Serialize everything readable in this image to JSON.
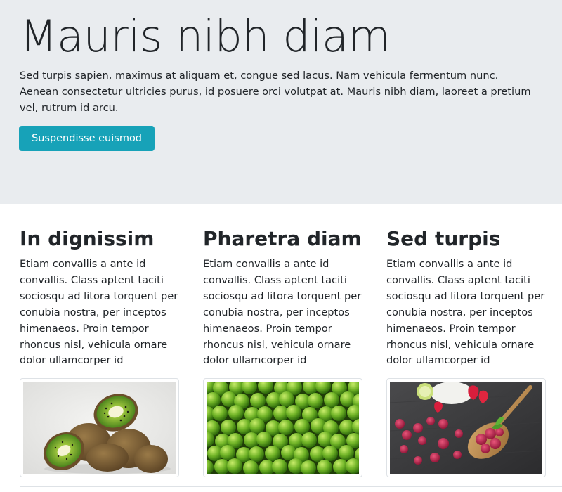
{
  "hero": {
    "title": "Mauris nibh diam",
    "lead": "Sed turpis sapien, maximus at aliquam et, congue sed lacus. Nam vehicula fermentum nunc. Aenean consectetur ultricies purus, id posuere orci volutpat at. Mauris nibh diam, laoreet a pretium vel, rutrum id arcu.",
    "button_label": "Suspendisse euismod",
    "button_color": "#17a2b8",
    "background": "#e9ecef"
  },
  "columns": [
    {
      "title": "In dignissim",
      "text": "Etiam convallis a ante id convallis. Class aptent taciti sociosqu ad litora torquent per conubia nostra, per inceptos himenaeos. Proin tempor rhoncus nisl, vehicula ornare dolor ullamcorper id",
      "image": "kiwi-fruit-image"
    },
    {
      "title": "Pharetra diam",
      "text": "Etiam convallis a ante id convallis. Class aptent taciti sociosqu ad litora torquent per conubia nostra, per inceptos himenaeos. Proin tempor rhoncus nisl, vehicula ornare dolor ullamcorper id",
      "image": "green-apples-image"
    },
    {
      "title": "Sed turpis",
      "text": "Etiam convallis a ante id convallis. Class aptent taciti sociosqu ad litora torquent per conubia nostra, per inceptos himenaeos. Proin tempor rhoncus nisl, vehicula ornare dolor ullamcorper id",
      "image": "raspberries-spoon-image"
    }
  ]
}
